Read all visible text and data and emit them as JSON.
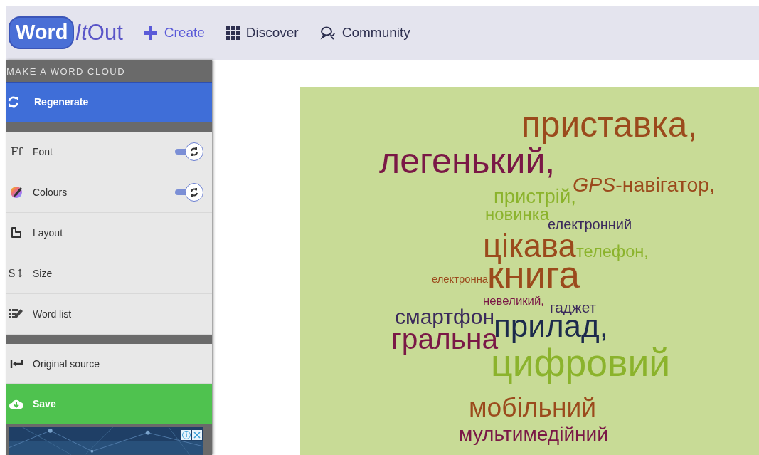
{
  "logo": {
    "badge": "Word",
    "accent": "It",
    "rest": "Out"
  },
  "nav": [
    {
      "label": "Create",
      "selected": true
    },
    {
      "label": "Discover",
      "selected": false
    },
    {
      "label": "Community",
      "selected": false
    }
  ],
  "sidebar": {
    "heading": "MAKE A WORD CLOUD",
    "actions": [
      {
        "label": "Regenerate",
        "kind": "primary"
      }
    ],
    "settings": [
      {
        "label": "Font",
        "glyph": "Ff",
        "kind": "toggle",
        "on": true
      },
      {
        "label": "Colours",
        "kind": "toggle",
        "on": true
      },
      {
        "label": "Layout",
        "kind": "item"
      },
      {
        "label": "Size",
        "glyph": "S↕",
        "kind": "item"
      },
      {
        "label": "Word list",
        "kind": "item"
      }
    ],
    "links": [
      {
        "label": "Original source",
        "kind": "item"
      },
      {
        "label": "Save",
        "kind": "save"
      }
    ]
  },
  "cloud": {
    "words": [
      {
        "text": "приставка,",
        "color": "#9b4a1c"
      },
      {
        "text": "легенький,",
        "color": "#7a1846"
      },
      {
        "text": "*GPS*-навігатор,",
        "color": "#9b4a1c"
      },
      {
        "text": "пристрій,",
        "color": "#8bb32c"
      },
      {
        "text": "новинка",
        "color": "#8bb32c"
      },
      {
        "text": "електронний",
        "color": "#3b2a5c"
      },
      {
        "text": "цікава",
        "color": "#9b4a1c"
      },
      {
        "text": "телефон,",
        "color": "#8bb32c"
      },
      {
        "text": "електронна",
        "color": "#9b4a1c"
      },
      {
        "text": "книга",
        "color": "#9b4a1c"
      },
      {
        "text": "невеликий,",
        "color": "#7a1846"
      },
      {
        "text": "гаджет",
        "color": "#3b2a5c"
      },
      {
        "text": "смартфон",
        "color": "#3b2a5c"
      },
      {
        "text": "прилад,",
        "color": "#1c2a4c"
      },
      {
        "text": "гральна",
        "color": "#7a1846"
      },
      {
        "text": "цифровий",
        "color": "#8bb32c"
      },
      {
        "text": "мобільний",
        "color": "#9b4a1c"
      },
      {
        "text": "мультимедійний",
        "color": "#7a1846"
      }
    ]
  }
}
